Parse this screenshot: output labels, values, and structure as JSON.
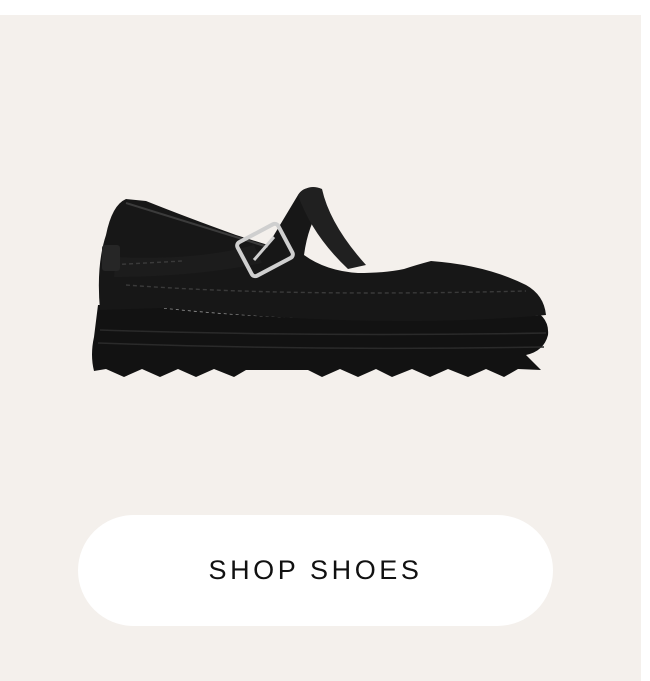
{
  "promo": {
    "image_icon": "black-leather-tbar-shoe",
    "cta_label": "SHOP SHOES"
  },
  "colors": {
    "card_background": "#f4f0ec",
    "button_background": "#ffffff",
    "button_text": "#111111",
    "shoe": "#151515"
  }
}
